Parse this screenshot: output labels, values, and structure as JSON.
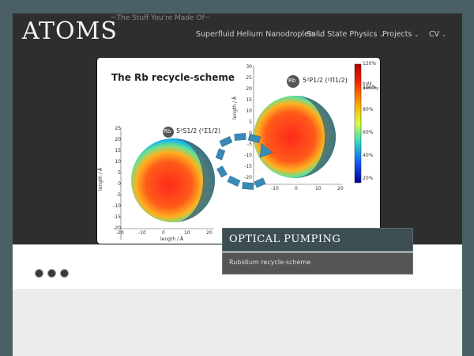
{
  "header": {
    "logo": "ATOMS",
    "tagline": "~The Stuff You're Made Of~",
    "nav": [
      {
        "label": "Superfluid Helium Nanodroplets"
      },
      {
        "label": "Solid State Physics"
      },
      {
        "label": "Projects"
      },
      {
        "label": "CV"
      }
    ]
  },
  "slide": {
    "title": "The Rb recycle-scheme",
    "left_atom_label": "Rb",
    "left_state": "5²S1/2 (²Σ1/2)",
    "right_atom_label": "Rb",
    "right_state": "5²P1/2 (²Π1/2)",
    "colorbar_ticks": [
      "120%",
      "100%",
      "80%",
      "60%",
      "40%",
      "20%"
    ],
    "colorbar_label": "bulk density",
    "left_y_ticks": [
      "25",
      "20",
      "15",
      "10",
      "5",
      "0",
      "-5",
      "-10",
      "-15",
      "-20"
    ],
    "left_x_ticks": [
      "-20",
      "-10",
      "0",
      "10",
      "20"
    ],
    "right_y_ticks": [
      "30",
      "25",
      "20",
      "15",
      "10",
      "5",
      "0",
      "-5",
      "-10",
      "-15",
      "-20"
    ],
    "right_x_ticks": [
      "-10",
      "0",
      "10",
      "20"
    ],
    "axis_label": "length / Å",
    "caption_title": "OPTICAL PUMPING",
    "caption_subtitle": "Rubidium recycle-scheme"
  },
  "slider_dots": 3
}
